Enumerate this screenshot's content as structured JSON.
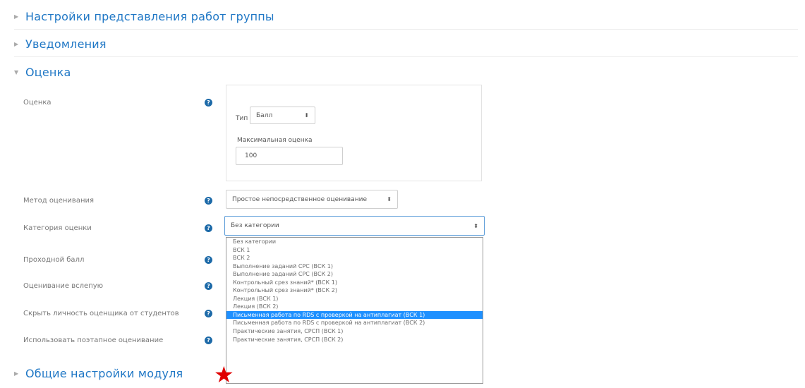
{
  "sections": {
    "group": "Настройки представления работ группы",
    "notifications": "Уведомления",
    "grade": "Оценка",
    "module": "Общие настройки модуля"
  },
  "fields": {
    "grade": "Оценка",
    "grading_method": "Метод оценивания",
    "grade_category": "Категория оценки",
    "pass_grade": "Проходной балл",
    "blind_marking": "Оценивание вслепую",
    "hide_grader": "Скрыть личность оценщика от студентов",
    "marking_workflow": "Использовать поэтапное оценивание"
  },
  "grade_box": {
    "type_label": "Тип",
    "type_value": "Балл",
    "max_label": "Максимальная оценка",
    "max_value": "100"
  },
  "grading_method_value": "Простое непосредственное оценивание",
  "category_select": {
    "value": "Без категории",
    "options": [
      "Без категории",
      "ВСК 1",
      "ВСК 2",
      "Выполнение заданий СРС (ВСК 1)",
      "Выполнение заданий СРС (ВСК 2)",
      "Контрольный срез знаний* (ВСК 1)",
      "Контрольный срез знаний* (ВСК 2)",
      "Лекция (ВСК 1)",
      "Лекция (ВСК 2)",
      "Письменная работа по RDS с проверкой на антиплагиат (ВСК 1)",
      "Письменная работа по RDS с проверкой на антиплагиат (ВСК 2)",
      "Практические занятия, СРСП (ВСК 1)",
      "Практические занятия, СРСП (ВСК 2)"
    ],
    "selected_index": 9
  },
  "colors": {
    "link": "#1f77c5",
    "highlight": "#1e90ff",
    "marker": "#e00000"
  },
  "icons": {
    "help": "question-circle-icon",
    "collapsed": "chevron-right-icon",
    "expanded": "chevron-down-icon",
    "marker": "star-icon"
  }
}
